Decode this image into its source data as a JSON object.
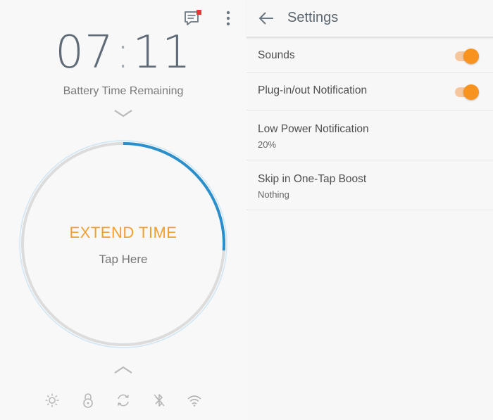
{
  "battery": {
    "hours": "07",
    "separator": ":",
    "minutes": "11",
    "label": "Battery Time Remaining",
    "action_title": "EXTEND TIME",
    "action_hint": "Tap Here",
    "dial_progress_percent": 26
  },
  "icons": {
    "messages": "message-icon",
    "more": "more-vertical-icon",
    "brightness": "brightness-icon",
    "lock": "rotation-lock-icon",
    "sync": "sync-icon",
    "bluetooth": "bluetooth-icon",
    "wifi": "wifi-icon"
  },
  "colors": {
    "accent": "#f7931e",
    "ring": "#2b8fcb",
    "badge": "#e53935"
  },
  "settings": {
    "title": "Settings",
    "items": [
      {
        "label": "Sounds",
        "toggle": true
      },
      {
        "label": "Plug-in/out Notification",
        "toggle": true
      },
      {
        "label": "Low Power Notification",
        "value": "20%"
      },
      {
        "label": "Skip in One-Tap Boost",
        "value": "Nothing"
      }
    ]
  }
}
